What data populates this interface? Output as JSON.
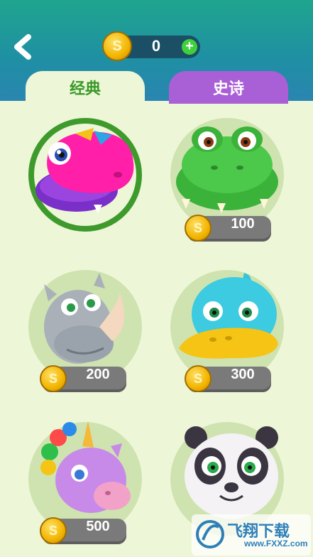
{
  "header": {
    "coin_symbol": "S",
    "coin_count": "0",
    "plus_label": "+"
  },
  "tabs": [
    {
      "label": "经典",
      "active": true
    },
    {
      "label": "史诗",
      "active": false
    }
  ],
  "characters": [
    {
      "name": "pink-dinosaur",
      "price": null,
      "selected": true
    },
    {
      "name": "crocodile",
      "price": "100"
    },
    {
      "name": "rhino",
      "price": "200"
    },
    {
      "name": "platypus",
      "price": "300"
    },
    {
      "name": "unicorn",
      "price": "500"
    },
    {
      "name": "panda",
      "price": null
    }
  ],
  "price_coin_symbol": "S",
  "watermark": {
    "text": "飞翔下载",
    "url_text": "www.FXXZ.com"
  },
  "colors": {
    "header": "#1fa58e",
    "epic_tab": "#a95fd6",
    "selected_ring": "#3f9a2c"
  }
}
